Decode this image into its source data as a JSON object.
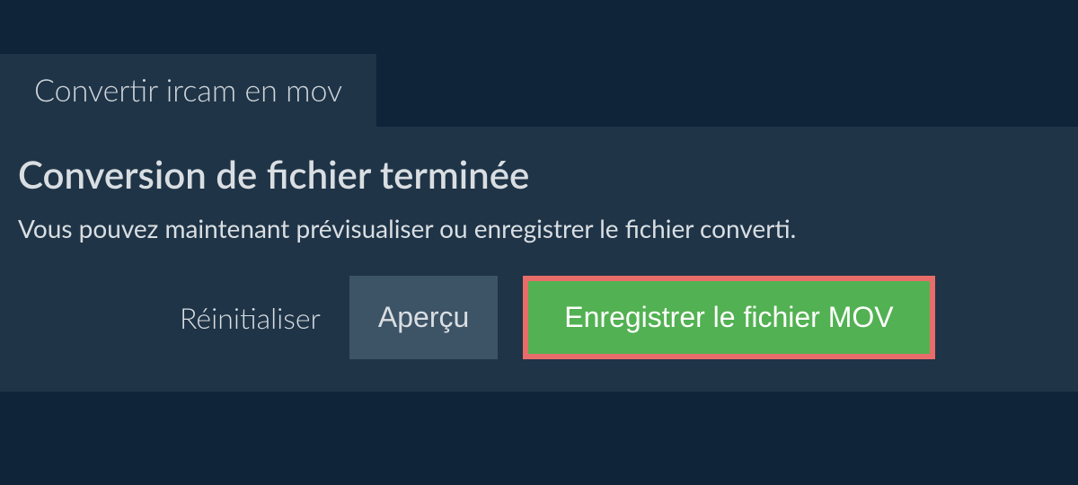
{
  "tab": {
    "label": "Convertir ircam en mov"
  },
  "content": {
    "heading": "Conversion de fichier terminée",
    "subheading": "Vous pouvez maintenant prévisualiser ou enregistrer le fichier converti."
  },
  "actions": {
    "reset_label": "Réinitialiser",
    "preview_label": "Aperçu",
    "save_label": "Enregistrer le fichier MOV"
  }
}
